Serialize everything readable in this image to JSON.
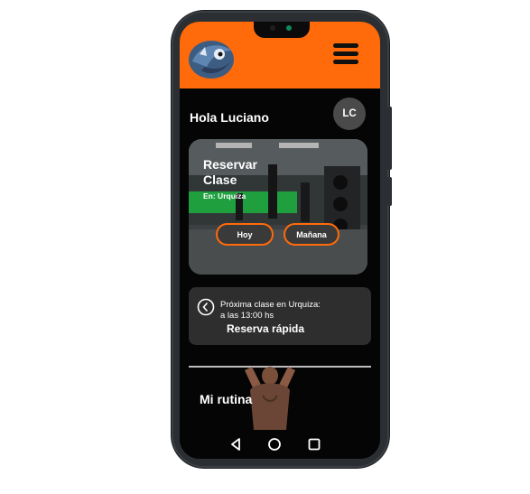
{
  "greeting": "Hola Luciano",
  "avatar_initials": "LC",
  "booking_card": {
    "title": "Reservar Clase",
    "location": "En: Urquiza",
    "buttons": [
      "Hoy",
      "Mañana"
    ]
  },
  "next_class": {
    "line1": "Próxima clase en Urquiza:",
    "line2": "a las 13:00 hs",
    "action": "Reserva rápida"
  },
  "routine": {
    "label": "Mi rutina"
  },
  "colors": {
    "accent": "#ff6a0a",
    "background": "#050505",
    "card": "#2e2e2e"
  },
  "icons": [
    "menu-icon",
    "clock-back-icon",
    "back-icon",
    "home-icon",
    "recents-icon"
  ]
}
